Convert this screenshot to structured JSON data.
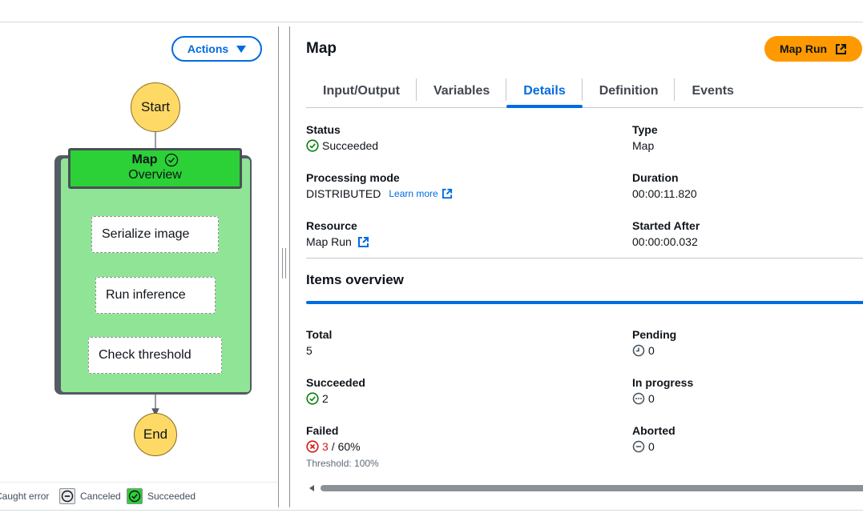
{
  "graph": {
    "actions_label": "Actions",
    "start_label": "Start",
    "end_label": "End",
    "map_title": "Map",
    "map_subtitle": "Overview",
    "tasks": [
      "Serialize image",
      "Run inference",
      "Check threshold"
    ],
    "legend": [
      {
        "label": "Caught error"
      },
      {
        "label": "Canceled"
      },
      {
        "label": "Succeeded"
      }
    ]
  },
  "panel": {
    "title": "Map",
    "map_run_button": "Map Run",
    "tabs": [
      "Input/Output",
      "Variables",
      "Details",
      "Definition",
      "Events"
    ],
    "active_tab": "Details",
    "details": {
      "status_label": "Status",
      "status_value": "Succeeded",
      "type_label": "Type",
      "type_value": "Map",
      "processing_mode_label": "Processing mode",
      "processing_mode_value": "DISTRIBUTED",
      "learn_more": "Learn more",
      "duration_label": "Duration",
      "duration_value": "00:00:11.820",
      "resource_label": "Resource",
      "resource_value": "Map Run",
      "started_after_label": "Started After",
      "started_after_value": "00:00:00.032"
    },
    "items_overview": {
      "title": "Items overview",
      "total_label": "Total",
      "total_value": "5",
      "pending_label": "Pending",
      "pending_value": "0",
      "succeeded_label": "Succeeded",
      "succeeded_value": "2",
      "in_progress_label": "In progress",
      "in_progress_value": "0",
      "failed_label": "Failed",
      "failed_value": "3",
      "failed_percent": "/ 60%",
      "threshold": "Threshold: 100%",
      "aborted_label": "Aborted",
      "aborted_value": "0"
    }
  },
  "colors": {
    "accent": "#006ce0",
    "success": "#037f0c",
    "error": "#d91515",
    "map_run_button": "#ff9900",
    "start_end_node": "#ffd966",
    "map_header": "#2bd136",
    "map_body": "#8fe595"
  }
}
